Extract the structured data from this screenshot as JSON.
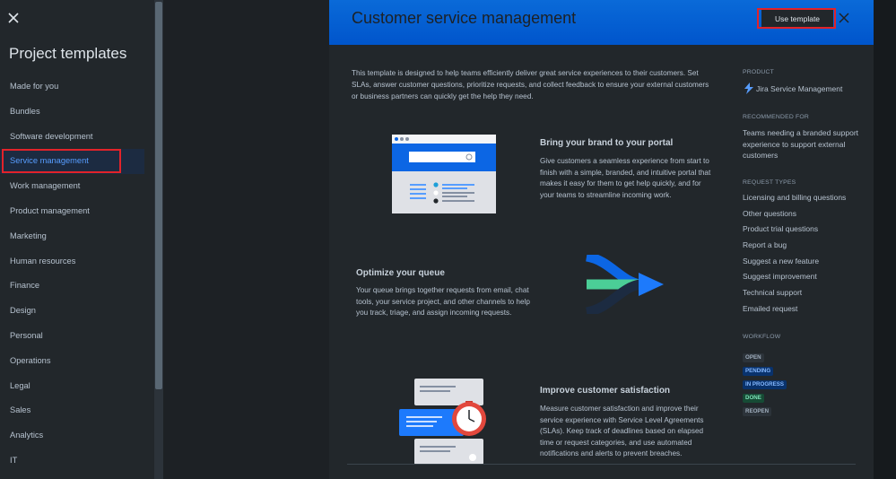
{
  "sidebar": {
    "title": "Project templates",
    "items": [
      {
        "label": "Made for you"
      },
      {
        "label": "Bundles"
      },
      {
        "label": "Software development"
      },
      {
        "label": "Service management",
        "active": true
      },
      {
        "label": "Work management"
      },
      {
        "label": "Product management"
      },
      {
        "label": "Marketing"
      },
      {
        "label": "Human resources"
      },
      {
        "label": "Finance"
      },
      {
        "label": "Design"
      },
      {
        "label": "Personal"
      },
      {
        "label": "Operations"
      },
      {
        "label": "Legal"
      },
      {
        "label": "Sales"
      },
      {
        "label": "Analytics"
      },
      {
        "label": "IT"
      }
    ]
  },
  "header": {
    "title": "Customer service management",
    "use_template_label": "Use template"
  },
  "main": {
    "description": "This template is designed to help teams efficiently deliver great service experiences to their customers. Set SLAs, answer customer questions, prioritize requests, and collect feedback to ensure your external customers or business partners can quickly get the help they need.",
    "features": [
      {
        "title": "Bring your brand to your portal",
        "text": "Give customers a seamless experience from start to finish with a simple, branded, and intuitive portal that makes it easy for them to get help quickly, and for your teams to streamline incoming work."
      },
      {
        "title": "Optimize your queue",
        "text": "Your queue brings together requests from email, chat tools, your service project, and other channels to help you track, triage, and assign incoming requests."
      },
      {
        "title": "Improve customer satisfaction",
        "text": "Measure customer satisfaction and improve their service experience with Service Level Agreements (SLAs). Keep track of deadlines based on elapsed time or request categories, and use automated notifications and alerts to prevent breaches."
      }
    ]
  },
  "side": {
    "product_heading": "PRODUCT",
    "product_name": "Jira Service Management",
    "recommended_heading": "RECOMMENDED FOR",
    "recommended_text": "Teams needing a branded support experience to support external customers",
    "request_types_heading": "REQUEST TYPES",
    "request_types": [
      "Licensing and billing questions",
      "Other questions",
      "Product trial questions",
      "Report a bug",
      "Suggest a new feature",
      "Suggest improvement",
      "Technical support",
      "Emailed request"
    ],
    "workflow_heading": "WORKFLOW",
    "workflow": [
      {
        "label": "OPEN",
        "bg": "#2c333a",
        "fg": "#9fadbc"
      },
      {
        "label": "PENDING",
        "bg": "#09326c",
        "fg": "#85b8ff"
      },
      {
        "label": "IN PROGRESS",
        "bg": "#09326c",
        "fg": "#85b8ff"
      },
      {
        "label": "DONE",
        "bg": "#164b35",
        "fg": "#7ee2b8"
      },
      {
        "label": "REOPEN",
        "bg": "#2c333a",
        "fg": "#9fadbc"
      }
    ]
  },
  "icons": {
    "close": "close-icon",
    "product_logo": "jira-service-management-logo"
  },
  "colors": {
    "accent": "#579dff",
    "header_blue": "#0055cc",
    "highlight_red": "#e2232a"
  }
}
